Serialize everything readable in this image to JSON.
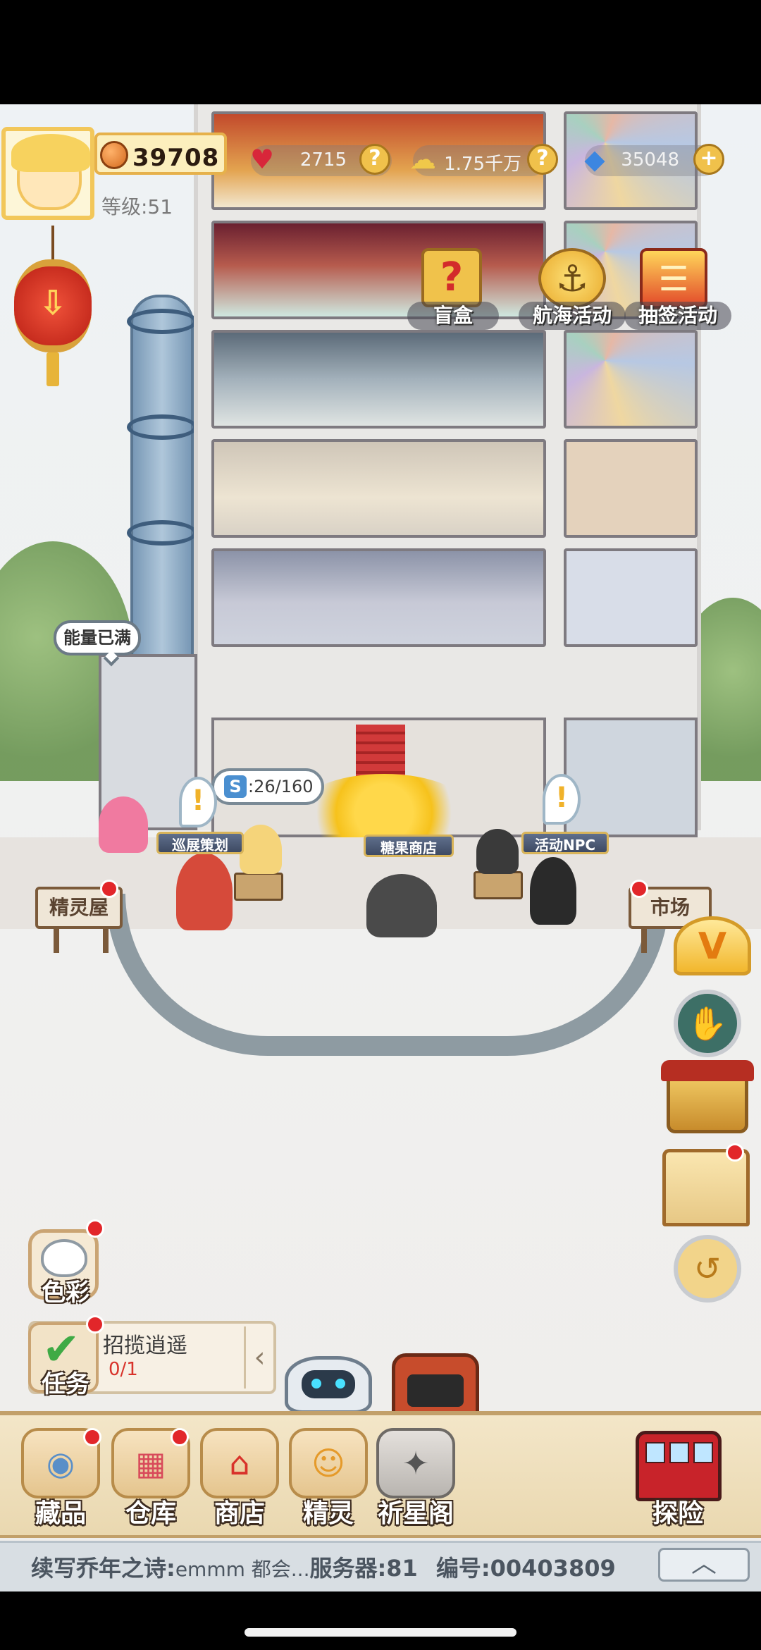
{
  "hud": {
    "coins": "39708",
    "level": "等级:51",
    "hearts": "2715",
    "gold": "1.75千万",
    "gems": "35048"
  },
  "events": {
    "blind_box": "盲盒",
    "sailing": "航海活动",
    "lottery": "抽签活动"
  },
  "scene": {
    "energy_full": "能量已满",
    "energy_count": ":26/160",
    "npc_tour": "巡展策划",
    "npc_candy": "糖果商店",
    "npc_event": "活动NPC",
    "sign_spirit_house": "精灵屋",
    "sign_market": "市场",
    "exclaim": "!"
  },
  "floating": {
    "color_label": "色彩",
    "task_label": "任务",
    "task_title": "招揽逍遥",
    "task_progress": "0/1"
  },
  "nav": {
    "items": [
      {
        "label": "藏品",
        "icon": "collection-icon"
      },
      {
        "label": "仓库",
        "icon": "warehouse-icon"
      },
      {
        "label": "商店",
        "icon": "shop-icon"
      },
      {
        "label": "精灵",
        "icon": "spirit-icon"
      },
      {
        "label": "祈星阁",
        "icon": "star-pavilion-icon"
      }
    ],
    "explore": "探险"
  },
  "ticker": {
    "prefix": "续写乔年之诗:",
    "message": "emmm 都会...",
    "server": "服务器:81",
    "id": "编号:00403809"
  },
  "colors": {
    "accent_gold": "#f2c75a",
    "alert_red": "#e2262a",
    "nav_bg": "#f3e6c8"
  }
}
